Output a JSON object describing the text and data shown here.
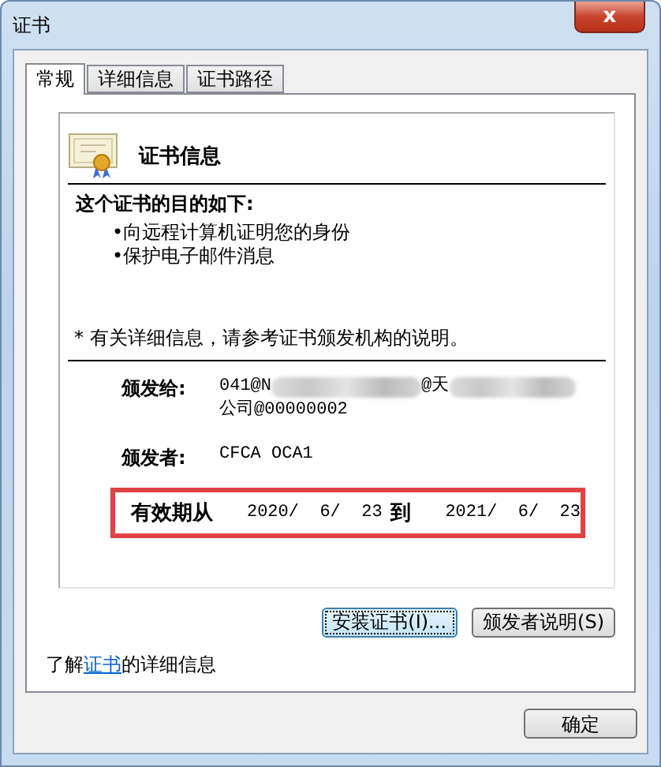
{
  "window": {
    "title": "证书",
    "close": "x"
  },
  "tabs": [
    {
      "label": "常规",
      "selected": true
    },
    {
      "label": "详细信息",
      "selected": false
    },
    {
      "label": "证书路径",
      "selected": false
    }
  ],
  "info": {
    "title": "证书信息",
    "purpose_heading": "这个证书的目的如下:",
    "purposes": [
      "•向远程计算机证明您的身份",
      "•保护电子邮件消息"
    ],
    "note": "* 有关详细信息，请参考证书颁发机构的说明。",
    "issued_to": {
      "label": "颁发给:",
      "line_1_parts": [
        "041@N",
        "@天"
      ],
      "line_2": "公司@00000002"
    },
    "issued_by": {
      "label": "颁发者:",
      "value": "CFCA OCA1"
    },
    "validity": {
      "from_label": "有效期从",
      "from": "2020/  6/  23",
      "to_label": "到",
      "to": "2021/  6/  23",
      "highlighted": true
    }
  },
  "buttons": [
    {
      "label": "安装证书(I)...",
      "focused": true
    },
    {
      "label": "颁发者说明(S)",
      "focused": false
    }
  ],
  "learn_more": {
    "before": "了解",
    "link": "证书",
    "after": "的详细信息"
  },
  "ok_button": "确定"
}
